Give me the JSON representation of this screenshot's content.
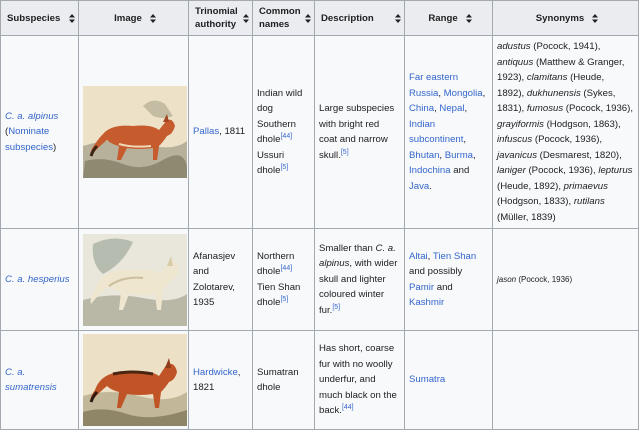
{
  "headers": {
    "subspecies": "Subspecies",
    "image": "Image",
    "authority_1": "Trinomial",
    "authority_2": "authority",
    "common_1": "Common",
    "common_2": "names",
    "description": "Description",
    "range": "Range",
    "synonyms": "Synonyms"
  },
  "sort_icon": "sort-arrows-icon",
  "rows": [
    {
      "subspecies_name": "C. a. alpinus",
      "subspecies_note_open": "(",
      "subspecies_note_link": "Nominate subspecies",
      "subspecies_note_close": ")",
      "image_alt": "red dhole illustration",
      "authority_link": "Pallas",
      "authority_text": ", 1811",
      "common_1": "Indian wild dog",
      "common_2": "Southern dhole",
      "common_2_ref": "[44]",
      "common_3": "Ussuri dhole",
      "common_3_ref": "[5]",
      "description": "Large subspecies with bright red coat and narrow skull.",
      "description_ref": "[5]",
      "range": [
        "Far eastern Russia",
        "Mongolia",
        "China",
        "Nepal",
        "Indian subcontinent",
        "Bhutan",
        "Burma",
        "Indochina",
        "Java"
      ],
      "range_sep_1": ", ",
      "range_and": " and ",
      "range_end": ".",
      "synonyms": [
        {
          "name": "adustus",
          "author": " (Pocock, 1941),"
        },
        {
          "name": "antiquus",
          "author": " (Matthew & Granger, 1923),"
        },
        {
          "name": "clamitans",
          "author": " (Heude, 1892),"
        },
        {
          "name": "dukhunensis",
          "author": " (Sykes, 1831),"
        },
        {
          "name": "fumosus",
          "author": " (Pocock, 1936),"
        },
        {
          "name": "grayiformis",
          "author": " (Hodgson, 1863),"
        },
        {
          "name": "infuscus",
          "author": " (Pocock, 1936),"
        },
        {
          "name": "javanicus",
          "author": " (Desmarest, 1820),"
        },
        {
          "name": "laniger",
          "author": " (Pocock, 1936),"
        },
        {
          "name": "lepturus",
          "author": " (Heude, 1892),"
        },
        {
          "name": "primaevus",
          "author": " (Hodgson, 1833),"
        },
        {
          "name": "rutilans",
          "author": " (Müller, 1839)"
        }
      ]
    },
    {
      "subspecies_name": "C. a. hesperius",
      "image_alt": "pale dhole illustration",
      "authority_text": "Afanasjev and Zolotarev, 1935",
      "common_1": "Northern dhole",
      "common_1_ref": "[44]",
      "common_2": "Tien Shan dhole",
      "common_2_ref": "[5]",
      "description_a": "Smaller than ",
      "description_i": "C. a. alpinus",
      "description_b": ", with wider skull and lighter coloured winter fur.",
      "description_ref": "[5]",
      "range_link_1": "Altai",
      "range_sep": ", ",
      "range_link_2": "Tien Shan",
      "range_text": " and possibly ",
      "range_link_3": "Pamir",
      "range_and": " and ",
      "range_link_4": "Kashmir",
      "synonym_name": "jason",
      "synonym_author": " (Pocock, 1936)"
    },
    {
      "subspecies_name": "C. a. sumatrensis",
      "image_alt": "Sumatran dhole illustration",
      "authority_link": "Hardwicke",
      "authority_text": ", 1821",
      "common_1": "Sumatran dhole",
      "description": "Has short, coarse fur with no woolly underfur, and much black on the back.",
      "description_ref": "[44]",
      "range_link": "Sumatra"
    }
  ]
}
